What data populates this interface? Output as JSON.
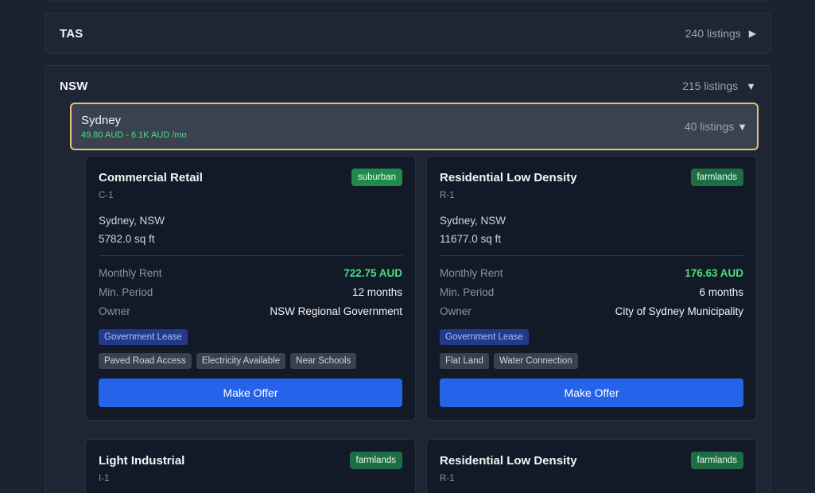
{
  "regions": [
    {
      "name": "TAS",
      "count": "240 listings"
    },
    {
      "name": "NSW",
      "count": "215 listings"
    }
  ],
  "city": {
    "name": "Sydney",
    "range": "49.80 AUD - 6.1K AUD /mo",
    "count": "40 listings"
  },
  "labels": {
    "rent": "Monthly Rent",
    "period": "Min. Period",
    "owner": "Owner",
    "offer": "Make Offer"
  },
  "listings": [
    {
      "title": "Commercial Retail",
      "code": "C-1",
      "badge": "suburban",
      "location": "Sydney, NSW",
      "area": "5782.0 sq ft",
      "rent": "722.75 AUD",
      "period": "12 months",
      "owner": "NSW Regional Government",
      "lease": "Government Lease",
      "tags": [
        "Paved Road Access",
        "Electricity Available",
        "Near Schools"
      ]
    },
    {
      "title": "Residential Low Density",
      "code": "R-1",
      "badge": "farmlands",
      "location": "Sydney, NSW",
      "area": "11677.0 sq ft",
      "rent": "176.63 AUD",
      "period": "6 months",
      "owner": "City of Sydney Municipality",
      "lease": "Government Lease",
      "tags": [
        "Flat Land",
        "Water Connection"
      ]
    },
    {
      "title": "Light Industrial",
      "code": "I-1",
      "badge": "farmlands"
    },
    {
      "title": "Residential Low Density",
      "code": "R-1",
      "badge": "farmlands"
    }
  ],
  "colors": {
    "accent": "#2563eb",
    "rent_green": "#4ade80",
    "selected_border": "#e8c171"
  },
  "icons": {
    "collapsed": "caret-right-icon",
    "expanded": "caret-down-icon"
  }
}
